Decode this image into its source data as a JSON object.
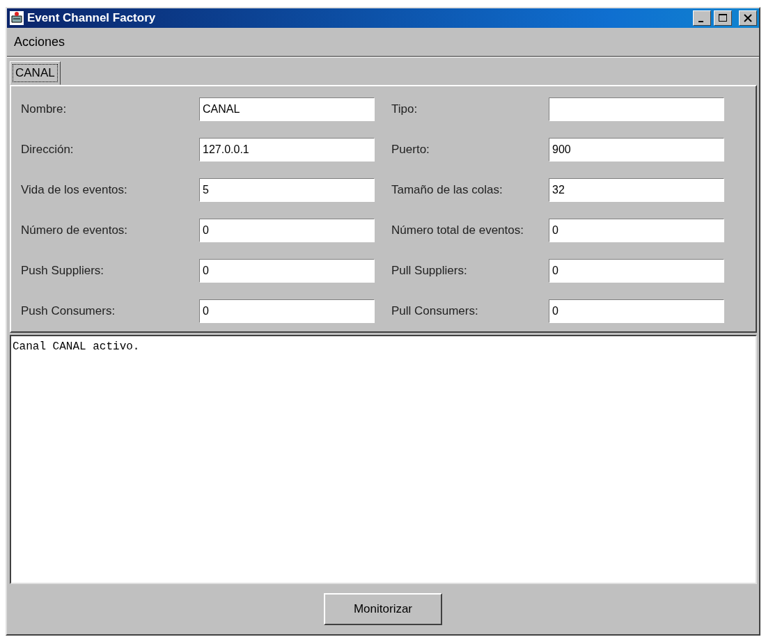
{
  "window": {
    "title": "Event Channel Factory"
  },
  "menu": [
    "Acciones"
  ],
  "tabs": [
    {
      "label": "CANAL",
      "selected": true
    }
  ],
  "fields": [
    {
      "label": "Nombre:",
      "value": "CANAL"
    },
    {
      "label": "Tipo:"
    },
    {
      "label": "Dirección:",
      "value": "127.0.0.1"
    },
    {
      "label": "Puerto:",
      "value": "900"
    },
    {
      "label": "Vida de los eventos:",
      "value": "5"
    },
    {
      "label": "Tamaño de las colas:",
      "value": "32"
    },
    {
      "label": "Número de eventos:",
      "value": "0"
    },
    {
      "label": "Número total de eventos:",
      "value": "0"
    },
    {
      "label": "Push Suppliers:",
      "value": "0"
    },
    {
      "label": "Pull Suppliers:",
      "value": "0"
    },
    {
      "label": "Push Consumers:",
      "value": "0"
    },
    {
      "label": "Pull Consumers:",
      "value": "0"
    }
  ],
  "log": "Canal CANAL activo.",
  "buttons": [
    "Monitorizar"
  ]
}
